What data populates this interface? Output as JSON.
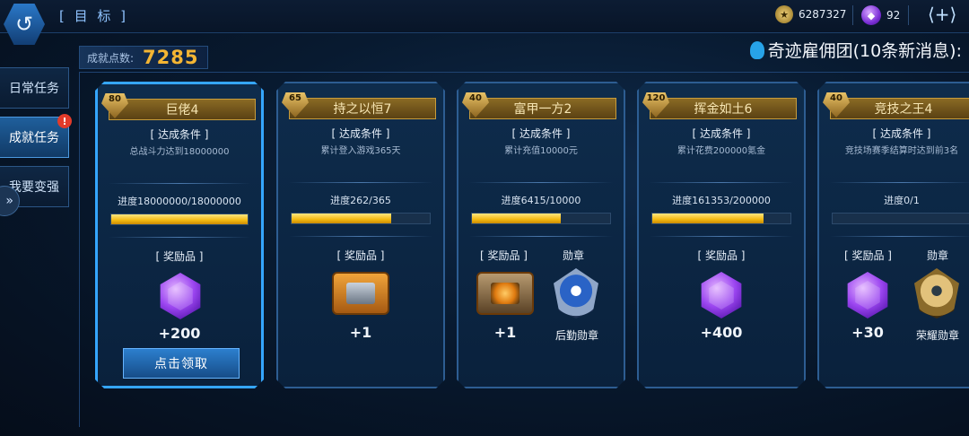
{
  "header": {
    "back_icon": "back-arrow-icon",
    "title": "[ 目 标 ]",
    "coins": "6287327",
    "gems": "92",
    "add_label": "⟨+⟩"
  },
  "score": {
    "label": "成就点数:",
    "value": "7285"
  },
  "notice": "奇迹雇佣团(10条新消息):",
  "nav": [
    {
      "label": "日常任务",
      "active": false
    },
    {
      "label": "成就任务",
      "active": true,
      "badge": "!"
    },
    {
      "label": "我要变强",
      "active": false
    }
  ],
  "nav_arrow": "»",
  "cards": [
    {
      "level": "80",
      "name": "巨佬4",
      "cond_title": "[ 达成条件 ]",
      "cond": "总战斗力达到18000000",
      "progress_text": "进度18000000/18000000",
      "progress": 1.0,
      "reward_title": "[ 奖励品 ]",
      "reward_amount": "+200",
      "claim": "点击领取"
    },
    {
      "level": "65",
      "name": "持之以恒7",
      "cond_title": "[ 达成条件 ]",
      "cond": "累计登入游戏365天",
      "progress_text": "进度262/365",
      "progress": 0.718,
      "reward_title": "[ 奖励品 ]",
      "reward_amount": "+1"
    },
    {
      "level": "40",
      "name": "富甲一方2",
      "cond_title": "[ 达成条件 ]",
      "cond": "累计充值10000元",
      "progress_text": "进度6415/10000",
      "progress": 0.6415,
      "reward_title": "[ 奖励品 ]",
      "reward_amount": "+1",
      "medal_title": "勋章",
      "medal_name": "后勤勋章"
    },
    {
      "level": "120",
      "name": "挥金如土6",
      "cond_title": "[ 达成条件 ]",
      "cond": "累计花费200000氪金",
      "progress_text": "进度161353/200000",
      "progress": 0.807,
      "reward_title": "[ 奖励品 ]",
      "reward_amount": "+400"
    },
    {
      "level": "40",
      "name": "竞技之王4",
      "cond_title": "[ 达成条件 ]",
      "cond": "竞技场赛季结算时达到前3名",
      "progress_text": "进度0/1",
      "progress": 0,
      "reward_title": "[ 奖励品 ]",
      "reward_amount": "+30",
      "medal_title": "勋章",
      "medal_name": "荣耀勋章"
    }
  ]
}
